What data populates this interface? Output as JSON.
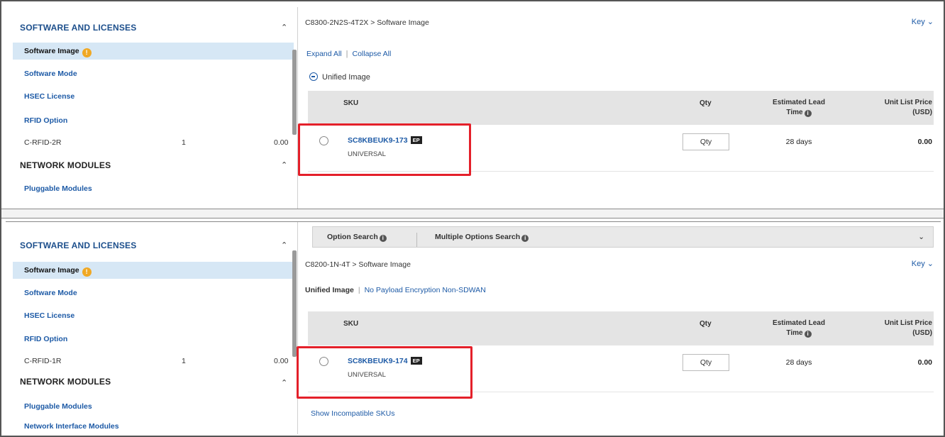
{
  "top": {
    "sidebar": {
      "section1": "SOFTWARE AND LICENSES",
      "items": [
        "Software Image",
        "Software Mode",
        "HSEC License",
        "RFID Option"
      ],
      "rfid": {
        "name": "C-RFID-2R",
        "qty": "1",
        "price": "0.00"
      },
      "section2": "NETWORK MODULES",
      "item_after": "Pluggable Modules"
    },
    "main": {
      "breadcrumb": "C8300-2N2S-4T2X > Software Image",
      "key_label": "Key ⌄",
      "expand_all": "Expand All",
      "collapse_all": "Collapse All",
      "unified_label": "Unified Image",
      "table": {
        "col_sku": "SKU",
        "col_qty": "Qty",
        "col_lead_1": "Estimated Lead",
        "col_lead_2": "Time",
        "col_price_1": "Unit List Price",
        "col_price_2": "(USD)",
        "row": {
          "sku": "SC8KBEUK9-173",
          "badge": "EP",
          "sub": "UNIVERSAL",
          "qty_placeholder": "Qty",
          "lead": "28 days",
          "price": "0.00"
        }
      }
    }
  },
  "bottom": {
    "sidebar": {
      "section1": "SOFTWARE AND LICENSES",
      "items": [
        "Software Image",
        "Software Mode",
        "HSEC License",
        "RFID Option"
      ],
      "rfid": {
        "name": "C-RFID-1R",
        "qty": "1",
        "price": "0.00"
      },
      "section2": "NETWORK MODULES",
      "items_after": [
        "Pluggable Modules",
        "Network Interface Modules"
      ]
    },
    "main": {
      "option_search": "Option Search",
      "multiple_options_search": "Multiple Options Search",
      "chevron": "⌄",
      "breadcrumb": "C8200-1N-4T > Software Image",
      "key_label": "Key ⌄",
      "unified_label": "Unified Image",
      "unified_link": "No Payload Encryption Non-SDWAN",
      "table": {
        "col_sku": "SKU",
        "col_qty": "Qty",
        "col_lead_1": "Estimated Lead",
        "col_lead_2": "Time",
        "col_price_1": "Unit List Price",
        "col_price_2": "(USD)",
        "row": {
          "sku": "SC8KBEUK9-174",
          "badge": "EP",
          "sub": "UNIVERSAL",
          "qty_placeholder": "Qty",
          "lead": "28 days",
          "price": "0.00"
        }
      },
      "show_incompatible": "Show Incompatible SKUs"
    }
  },
  "colors": {
    "accent": "#1d5aa6",
    "highlight": "#e4202a",
    "active_bg": "#d6e7f5"
  }
}
